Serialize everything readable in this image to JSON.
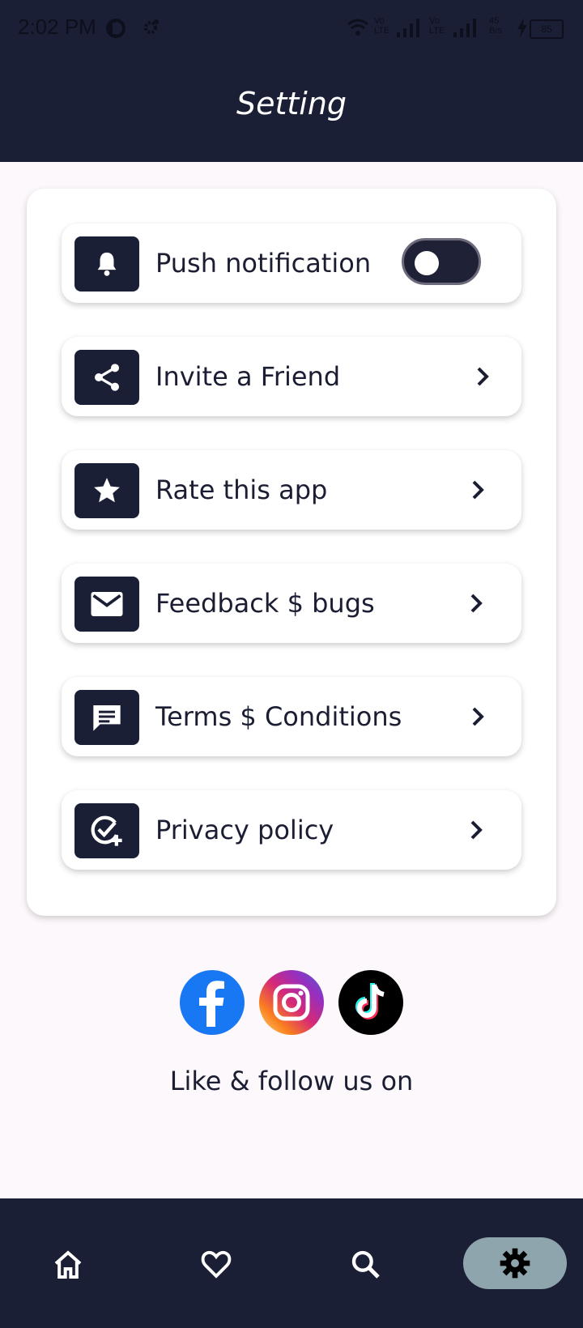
{
  "status_bar": {
    "time": "2:02 PM",
    "net1": "Vo\nLTE",
    "net2": "Vo\nLTE",
    "speed": "45\nB/s",
    "battery": "85"
  },
  "header": {
    "title": "Setting"
  },
  "settings": {
    "items": [
      {
        "label": "Push notification",
        "icon": "bell-icon",
        "control": "toggle",
        "toggle_on": false
      },
      {
        "label": "Invite a Friend",
        "icon": "share-icon",
        "control": "chevron"
      },
      {
        "label": "Rate this app",
        "icon": "star-icon",
        "control": "chevron"
      },
      {
        "label": "Feedback $ bugs",
        "icon": "mail-icon",
        "control": "chevron"
      },
      {
        "label": "Terms $ Conditions",
        "icon": "chat-icon",
        "control": "chevron"
      },
      {
        "label": "Privacy policy",
        "icon": "check-add-icon",
        "control": "chevron"
      }
    ]
  },
  "social": {
    "caption": "Like & follow us on",
    "links": [
      "facebook-icon",
      "instagram-icon",
      "tiktok-icon"
    ]
  },
  "bottom_nav": {
    "items": [
      "home-icon",
      "heart-icon",
      "search-icon",
      "gear-icon"
    ],
    "active": "gear-icon"
  },
  "colors": {
    "primary_dark": "#1b1f35",
    "background": "#fdf8fb",
    "nav_active": "#8fa5ad"
  }
}
